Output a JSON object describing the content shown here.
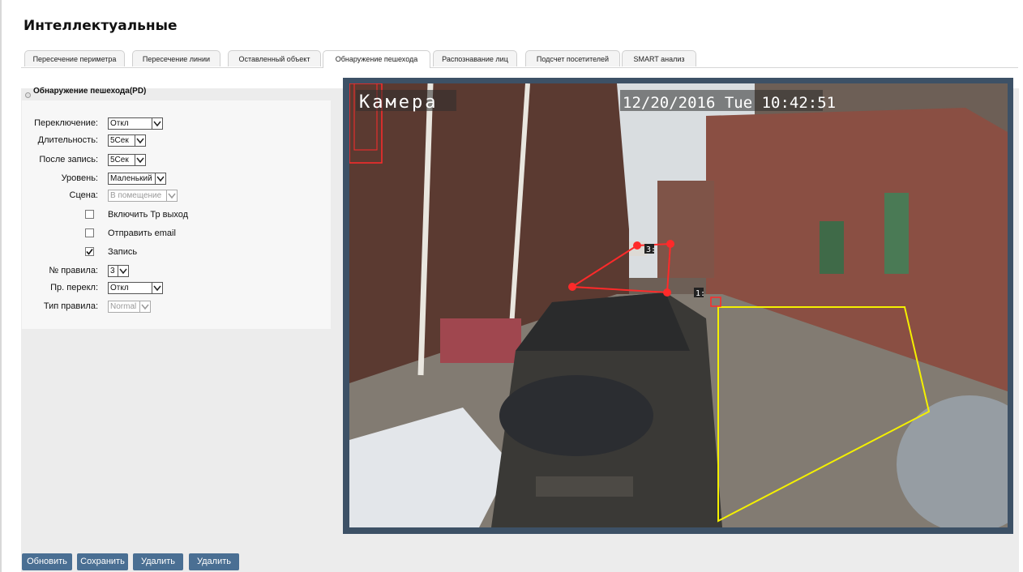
{
  "page": {
    "title": "Интеллектуальные"
  },
  "tabs": [
    {
      "label": "Пересечение периметра",
      "active": false
    },
    {
      "label": "Пересечение линии",
      "active": false
    },
    {
      "label": "Оставленный объект",
      "active": false
    },
    {
      "label": "Обнаружение пешехода",
      "active": true
    },
    {
      "label": "Распознавание лиц",
      "active": false
    },
    {
      "label": "Подсчет посетителей",
      "active": false
    },
    {
      "label": "SMART анализ",
      "active": false
    }
  ],
  "section": {
    "title": "Обнаружение пешехода(PD)"
  },
  "form": {
    "switch": {
      "label": "Переключение:",
      "value": "Откл"
    },
    "duration": {
      "label": "Длительность:",
      "value": "5Сек"
    },
    "post_record": {
      "label": "После запись:",
      "value": "5Сек"
    },
    "level": {
      "label": "Уровень:",
      "value": "Маленький"
    },
    "scene": {
      "label": "Сцена:",
      "value": "В помещение",
      "disabled": true
    },
    "tp_output": {
      "label": "Включить Тр выход",
      "checked": false
    },
    "send_email": {
      "label": "Отправить email",
      "checked": false
    },
    "record": {
      "label": "Запись",
      "checked": true
    },
    "rule_number": {
      "label": "№ правила:",
      "value": "3"
    },
    "rule_switch": {
      "label": "Пр. перекл:",
      "value": "Откл"
    },
    "rule_type": {
      "label": "Тип правила:",
      "value": "Normal",
      "disabled": true
    }
  },
  "video": {
    "camera_name": "Камера",
    "timestamp": "12/20/2016 Tue 10:42:51",
    "zone_labels": [
      "1:",
      "3:"
    ],
    "colors": {
      "red_zone": "#ff2a2a",
      "yellow_zone": "#f4f000",
      "frame": "#3d5166"
    }
  },
  "buttons": {
    "refresh": "Обновить",
    "save": "Сохранить",
    "delete_1": "Удалить",
    "delete_2": "Удалить"
  },
  "colors": {
    "button_bg": "#4a6f93",
    "content_bg": "#ececec",
    "panel_bg": "#f7f7f7"
  }
}
